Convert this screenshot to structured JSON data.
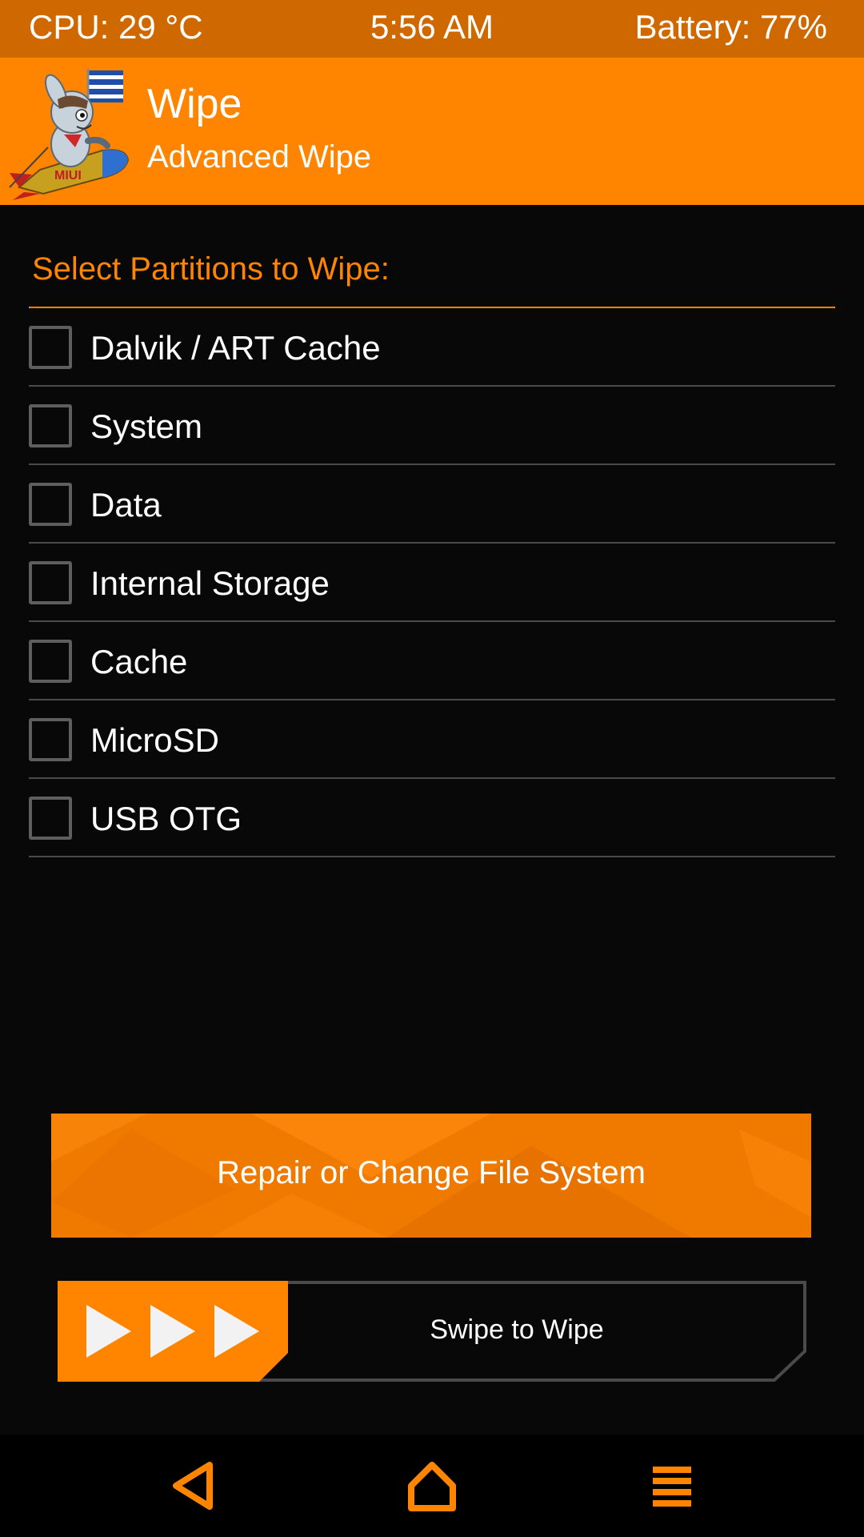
{
  "status_bar": {
    "cpu": "CPU: 29 °C",
    "time": "5:56 AM",
    "battery": "Battery: 77%"
  },
  "header": {
    "title": "Wipe",
    "subtitle": "Advanced Wipe",
    "logo_icon": "miui-rocket-mascot-logo"
  },
  "section": {
    "label": "Select Partitions to Wipe:"
  },
  "partitions": [
    {
      "label": "Dalvik / ART Cache",
      "checked": false
    },
    {
      "label": "System",
      "checked": false
    },
    {
      "label": "Data",
      "checked": false
    },
    {
      "label": "Internal Storage",
      "checked": false
    },
    {
      "label": "Cache",
      "checked": false
    },
    {
      "label": "MicroSD",
      "checked": false
    },
    {
      "label": "USB OTG",
      "checked": false
    }
  ],
  "repair_button": {
    "label": "Repair or Change File System"
  },
  "swipe": {
    "label": "Swipe to Wipe",
    "handle_icon": "triple-play-arrows-icon"
  },
  "nav": {
    "back_icon": "back-triangle-icon",
    "home_icon": "home-icon",
    "menu_icon": "menu-icon"
  },
  "colors": {
    "accent": "#ff8400",
    "status_bar": "#d06800",
    "background": "#080808",
    "divider": "#4a4a4a",
    "checkbox_border": "#5e5e5e"
  }
}
